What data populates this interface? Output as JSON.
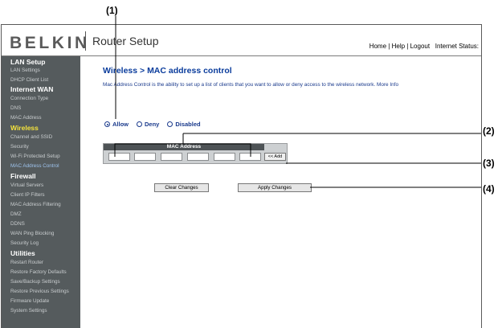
{
  "callouts": [
    "(1)",
    "(2)",
    "(3)",
    "(4)"
  ],
  "header": {
    "logo": "BELKIN",
    "title": "Router Setup",
    "links": {
      "home": "Home",
      "help": "Help",
      "logout": "Logout",
      "sep": "|",
      "status": "Internet Status:"
    }
  },
  "sidebar": {
    "sections": [
      {
        "heading": "LAN Setup",
        "items": [
          "LAN Settings",
          "DHCP Client List"
        ]
      },
      {
        "heading": "Internet WAN",
        "items": [
          "Connection Type",
          "DNS",
          "MAC Address"
        ]
      },
      {
        "heading": "Wireless",
        "items": [
          "Channel and SSID",
          "Security",
          "Wi-Fi Protected Setup",
          "MAC Address Control"
        ]
      },
      {
        "heading": "Firewall",
        "items": [
          "Virtual Servers",
          "Client IP Filters",
          "MAC Address Filtering",
          "DMZ",
          "DDNS",
          "WAN Ping Blocking",
          "Security Log"
        ]
      },
      {
        "heading": "Utilities",
        "items": [
          "Restart Router",
          "Restore Factory Defaults",
          "Save/Backup Settings",
          "Restore Previous Settings",
          "Firmware Update",
          "System Settings"
        ]
      }
    ],
    "active_section": "Wireless",
    "current_item": "MAC Address Control"
  },
  "main": {
    "title": "Wireless > MAC address control",
    "description": "Mac Address Control is the ability to set up a list of clients that you want to allow or deny access to the wireless network.",
    "more_info": "More Info",
    "mode_options": [
      "Allow",
      "Deny",
      "Disabled"
    ],
    "selected_mode": "Allow",
    "mac_header": "MAC Address",
    "add_label": "<< Add",
    "clear_label": "Clear Changes",
    "apply_label": "Apply Changes"
  }
}
